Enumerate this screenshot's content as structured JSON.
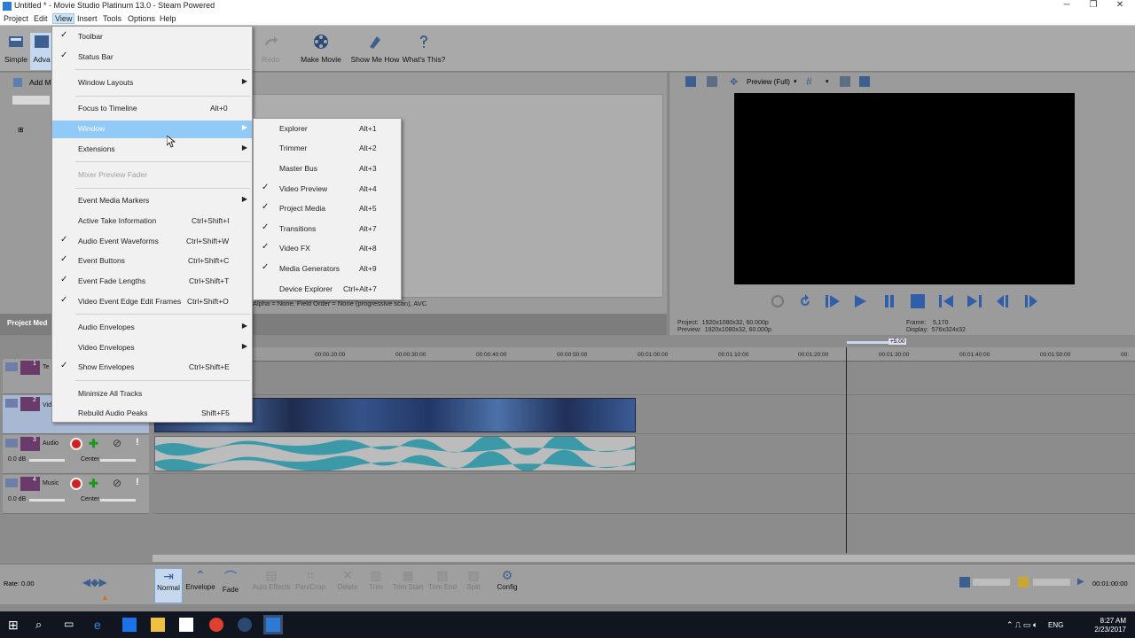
{
  "window": {
    "title": "Untitled * - Movie Studio Platinum 13.0 - Steam Powered",
    "controls": [
      "─",
      "❐",
      "✕"
    ]
  },
  "menubar": [
    "Project",
    "Edit",
    "View",
    "Insert",
    "Tools",
    "Options",
    "Help"
  ],
  "toolbar": {
    "simple": "Simple",
    "advanced": "Adva",
    "redo": "Redo",
    "make_movie": "Make Movie",
    "show_me_how": "Show Me How",
    "whats_this": "What's This?"
  },
  "explorer": {
    "add_label": "Add M",
    "info": "Alpha = None, Field Order = None (progressive scan), AVC",
    "tab": "Project Med"
  },
  "preview": {
    "mode": "Preview (Full)",
    "project_label": "Project:",
    "project_value": "1920x1080x32, 60.000p",
    "preview_label": "Preview:",
    "preview_value": "1920x1080x32, 60.000p",
    "frame_label": "Frame:",
    "frame_value": "5,170",
    "display_label": "Display:",
    "display_value": "576x324x32",
    "rate_badge": "+5.00"
  },
  "ruler": [
    "00:00:20:00",
    "00:00:30:00",
    "00:00:40:00",
    "00:00:50:00",
    "00:01:00:00",
    "00:01:10:00",
    "00:01:20:00",
    "00:01:30:00",
    "00:01:40:00",
    "00:01:50:00",
    "00:"
  ],
  "tracks": [
    {
      "num": "1",
      "name": "Te"
    },
    {
      "num": "2",
      "name": "Vid"
    },
    {
      "num": "3",
      "name": "Audio",
      "vol": "0.0 dB",
      "pan": "Center"
    },
    {
      "num": "4",
      "name": "Music",
      "vol": "0.0 dB",
      "pan": "Center"
    }
  ],
  "rate": "Rate: 0.00",
  "bottom_tools": [
    {
      "label": "Normal",
      "state": "selected"
    },
    {
      "label": "Envelope",
      "state": "enabled"
    },
    {
      "label": "Fade",
      "state": "enabled"
    },
    {
      "label": "Auto Effects",
      "state": "disabled"
    },
    {
      "label": "Pan/Crop",
      "state": "disabled"
    },
    {
      "label": "Delete",
      "state": "disabled"
    },
    {
      "label": "Trim",
      "state": "disabled"
    },
    {
      "label": "Trim Start",
      "state": "disabled"
    },
    {
      "label": "Trim End",
      "state": "disabled"
    },
    {
      "label": "Split",
      "state": "disabled"
    },
    {
      "label": "Config",
      "state": "enabled"
    }
  ],
  "bottom_time": "00:01:00:00",
  "view_menu": [
    {
      "label": "Toolbar",
      "checked": true
    },
    {
      "label": "Status Bar",
      "checked": true
    },
    {
      "label": "Window Layouts",
      "submenu": true
    },
    {
      "label": "Focus to Timeline",
      "shortcut": "Alt+0"
    },
    {
      "label": "Window",
      "submenu": true,
      "highlighted": true
    },
    {
      "label": "Extensions",
      "submenu": true
    },
    {
      "label": "Mixer Preview Fader",
      "disabled": true
    },
    {
      "label": "Event Media Markers",
      "submenu": true
    },
    {
      "label": "Active Take Information",
      "shortcut": "Ctrl+Shift+I"
    },
    {
      "label": "Audio Event Waveforms",
      "shortcut": "Ctrl+Shift+W",
      "checked": true
    },
    {
      "label": "Event Buttons",
      "shortcut": "Ctrl+Shift+C",
      "checked": true
    },
    {
      "label": "Event Fade Lengths",
      "shortcut": "Ctrl+Shift+T",
      "checked": true
    },
    {
      "label": "Video Event Edge Edit Frames",
      "shortcut": "Ctrl+Shift+O",
      "checked": true
    },
    {
      "label": "Audio Envelopes",
      "submenu": true
    },
    {
      "label": "Video Envelopes",
      "submenu": true
    },
    {
      "label": "Show Envelopes",
      "shortcut": "Ctrl+Shift+E",
      "checked": true
    },
    {
      "label": "Minimize All Tracks"
    },
    {
      "label": "Rebuild Audio Peaks",
      "shortcut": "Shift+F5"
    }
  ],
  "window_submenu": [
    {
      "label": "Explorer",
      "shortcut": "Alt+1"
    },
    {
      "label": "Trimmer",
      "shortcut": "Alt+2"
    },
    {
      "label": "Master Bus",
      "shortcut": "Alt+3"
    },
    {
      "label": "Video Preview",
      "shortcut": "Alt+4",
      "checked": true
    },
    {
      "label": "Project Media",
      "shortcut": "Alt+5",
      "checked": true
    },
    {
      "label": "Transitions",
      "shortcut": "Alt+7",
      "checked": true
    },
    {
      "label": "Video FX",
      "shortcut": "Alt+8",
      "checked": true
    },
    {
      "label": "Media Generators",
      "shortcut": "Alt+9",
      "checked": true
    },
    {
      "label": "Device Explorer",
      "shortcut": "Ctrl+Alt+7"
    }
  ],
  "tray": {
    "lang": "ENG",
    "time": "8:27 AM",
    "date": "2/23/2017"
  },
  "colors": {
    "accent": "#91c9f7",
    "menu_bg": "#f1f1f1",
    "taskbar": "#101520"
  }
}
